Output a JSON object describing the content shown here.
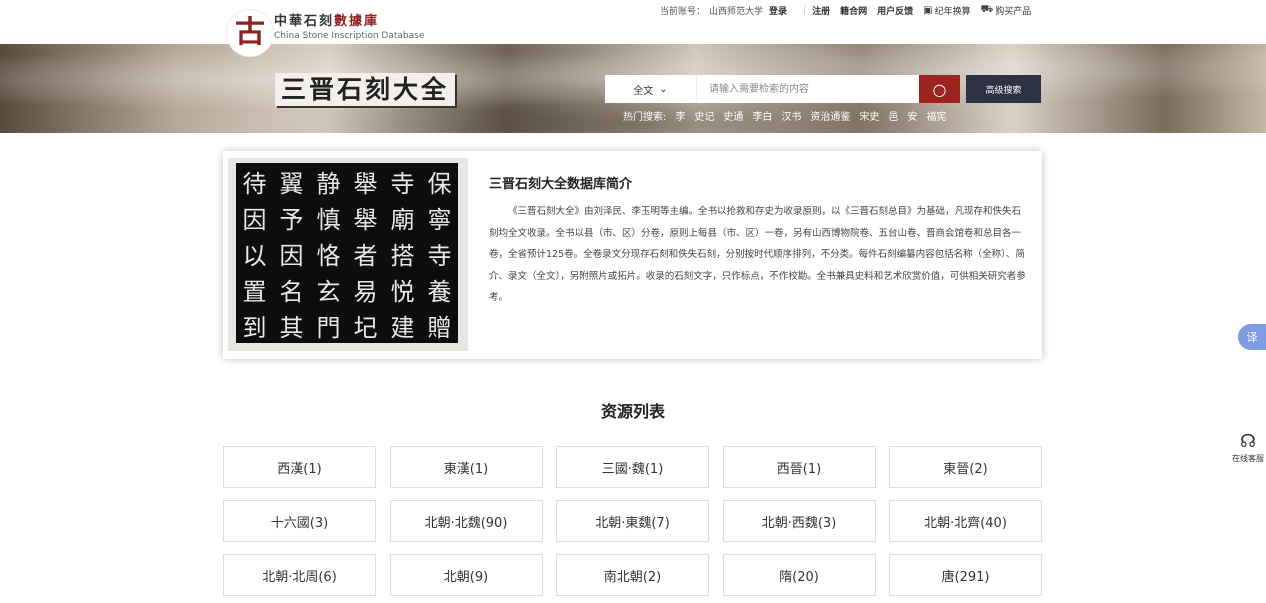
{
  "header": {
    "logo_glyph": "古",
    "logo_cn_main": "中華石刻",
    "logo_cn_accent": "數據庫",
    "logo_en": "China Stone Inscription Database",
    "account_label": "当前账号：",
    "account_name": "山西师范大学",
    "login": "登录",
    "register": "注册",
    "links": [
      "籍合网",
      "用户反馈"
    ],
    "calendar": "纪年换算",
    "buy": "购买产品"
  },
  "banner": {
    "title": "三晋石刻大全",
    "search_scope": "全文",
    "search_placeholder": "请输入需要检索的内容",
    "advanced": "高级搜索",
    "hot_label": "热门搜索:",
    "hot_terms": [
      "李",
      "史记",
      "史通",
      "李白",
      "汉书",
      "资治通鉴",
      "宋史",
      "邑",
      "安",
      "福宪"
    ]
  },
  "intro": {
    "title": "三晋石刻大全数据库简介",
    "body": "《三晋石刻大全》由刘泽民、李玉明等主编。全书以抢救和存史为收录原则，以《三晋石刻总目》为基础，凡现存和佚失石刻均全文收录。全书以县（市、区）分卷，原则上每县（市、区）一卷，另有山西博物院卷、五台山卷、晋商会馆卷和总目各一卷，全省预计125卷。全卷录文分现存石刻和佚失石刻，分别按时代顺序排列，不分类。每件石刻编纂内容包括名称（全称）、简介、录文（全文），另附照片或拓片。收录的石刻文字，只作标点，不作校勘。全书兼具史料和艺术欣赏价值，可供相关研究者参考。",
    "rubbing_chars": [
      "保",
      "寺",
      "舉",
      "静",
      "翼",
      "待",
      "寧",
      "廟",
      "舉",
      "慎",
      "予",
      "因",
      "寺",
      "搭",
      "者",
      "恪",
      "因",
      "以",
      "養",
      "悦",
      "易",
      "玄",
      "名",
      "置",
      "贈",
      "建",
      "圮",
      "門",
      "其",
      "到"
    ]
  },
  "resources": {
    "title": "资源列表",
    "items": [
      "西漢(1)",
      "東漢(1)",
      "三國·魏(1)",
      "西晉(1)",
      "東晉(2)",
      "十六國(3)",
      "北朝·北魏(90)",
      "北朝·東魏(7)",
      "北朝·西魏(3)",
      "北朝·北齊(40)",
      "北朝·北周(6)",
      "北朝(9)",
      "南北朝(2)",
      "隋(20)",
      "唐(291)"
    ]
  },
  "side": {
    "translate": "译",
    "service": "在线客服"
  }
}
